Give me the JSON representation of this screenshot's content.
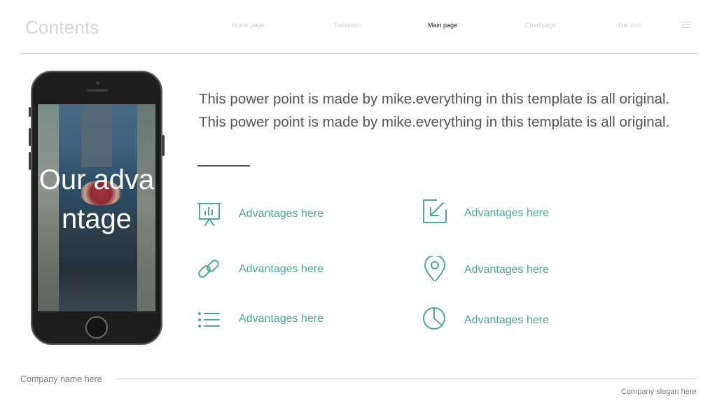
{
  "header": {
    "brand": "Contents",
    "nav": [
      {
        "label": "Home  page",
        "active": false
      },
      {
        "label": "Transition",
        "active": false
      },
      {
        "label": "Main page",
        "active": true
      },
      {
        "label": "Chart page",
        "active": false
      },
      {
        "label": "The end",
        "active": false
      }
    ],
    "menu_icon": "hamburger-icon"
  },
  "phone": {
    "screen_title": "Our advantage"
  },
  "intro": {
    "line1": "This power point is made by mike.everything in this template is all original.",
    "line2": "This power point is made by mike.everything in this template is all original."
  },
  "advantages": [
    {
      "icon": "presentation-chart-icon",
      "label": "Advantages here"
    },
    {
      "icon": "arrow-down-left-icon",
      "label": "Advantages here"
    },
    {
      "icon": "link-icon",
      "label": "Advantages here"
    },
    {
      "icon": "location-pin-icon",
      "label": "Advantages here"
    },
    {
      "icon": "list-icon",
      "label": "Advantages here"
    },
    {
      "icon": "pie-chart-icon",
      "label": "Advantages here"
    }
  ],
  "footer": {
    "company_name": "Company name here",
    "slogan": "Company slogan here"
  },
  "colors": {
    "accent": "#4aa894",
    "text": "#555555",
    "muted": "#cfcfcf",
    "active_nav": "#222222"
  }
}
